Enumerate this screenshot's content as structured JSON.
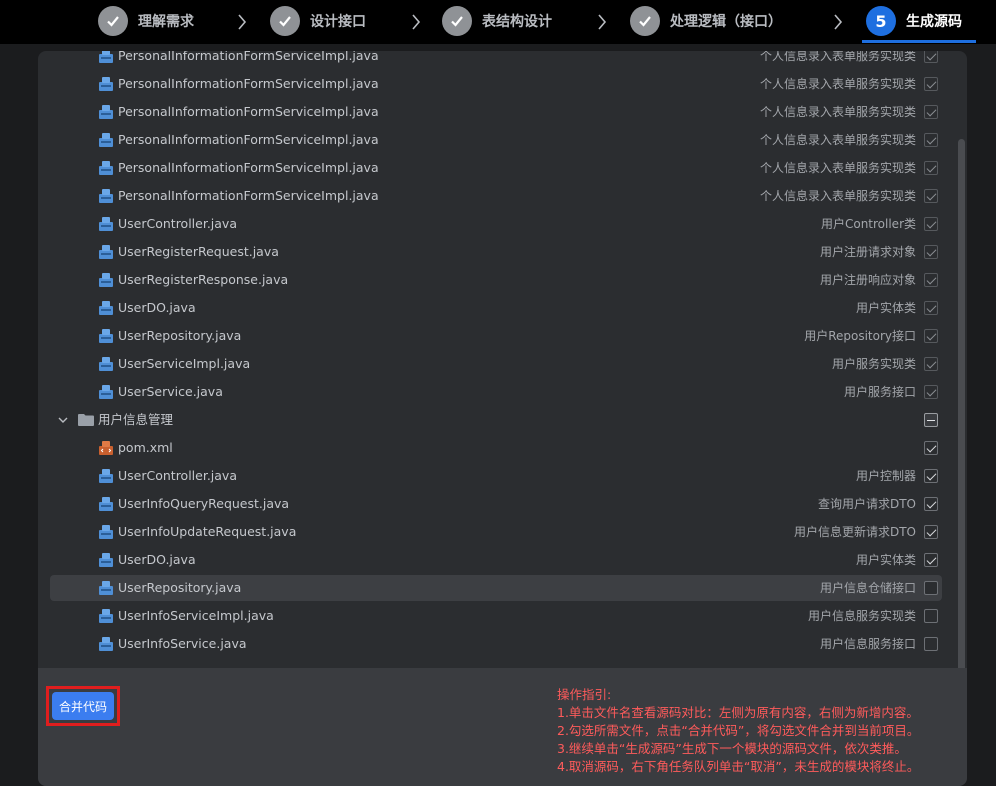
{
  "steps": [
    {
      "label": "理解需求",
      "status": "done"
    },
    {
      "label": "设计接口",
      "status": "done"
    },
    {
      "label": "表结构设计",
      "status": "done"
    },
    {
      "label": "处理逻辑（接口）",
      "status": "done"
    },
    {
      "label": "生成源码",
      "status": "active",
      "number": "5"
    }
  ],
  "tree": {
    "group1_files": [
      {
        "name": "PersonalInformationFormServiceImpl.java",
        "desc": "个人信息录入表单服务实现类",
        "checked": true
      },
      {
        "name": "PersonalInformationFormServiceImpl.java",
        "desc": "个人信息录入表单服务实现类",
        "checked": true
      },
      {
        "name": "PersonalInformationFormServiceImpl.java",
        "desc": "个人信息录入表单服务实现类",
        "checked": true
      },
      {
        "name": "PersonalInformationFormServiceImpl.java",
        "desc": "个人信息录入表单服务实现类",
        "checked": true
      },
      {
        "name": "PersonalInformationFormServiceImpl.java",
        "desc": "个人信息录入表单服务实现类",
        "checked": true
      },
      {
        "name": "PersonalInformationFormServiceImpl.java",
        "desc": "个人信息录入表单服务实现类",
        "checked": true
      },
      {
        "name": "UserController.java",
        "desc": "用户Controller类",
        "checked": true
      },
      {
        "name": "UserRegisterRequest.java",
        "desc": "用户注册请求对象",
        "checked": true
      },
      {
        "name": "UserRegisterResponse.java",
        "desc": "用户注册响应对象",
        "checked": true
      },
      {
        "name": "UserDO.java",
        "desc": "用户实体类",
        "checked": true
      },
      {
        "name": "UserRepository.java",
        "desc": "用户Repository接口",
        "checked": true
      },
      {
        "name": "UserServiceImpl.java",
        "desc": "用户服务实现类",
        "checked": true
      },
      {
        "name": "UserService.java",
        "desc": "用户服务接口",
        "checked": true
      }
    ],
    "folder": {
      "name": "用户信息管理",
      "state": "partial"
    },
    "group2_files": [
      {
        "name": "pom.xml",
        "desc": "",
        "checked": true,
        "icon": "xml-file-icon"
      },
      {
        "name": "UserController.java",
        "desc": "用户控制器",
        "checked": true
      },
      {
        "name": "UserInfoQueryRequest.java",
        "desc": "查询用户请求DTO",
        "checked": true
      },
      {
        "name": "UserInfoUpdateRequest.java",
        "desc": "用户信息更新请求DTO",
        "checked": true
      },
      {
        "name": "UserDO.java",
        "desc": "用户实体类",
        "checked": true
      },
      {
        "name": "UserRepository.java",
        "desc": "用户信息仓储接口",
        "checked": false,
        "highlight": true
      },
      {
        "name": "UserInfoServiceImpl.java",
        "desc": "用户信息服务实现类",
        "checked": false
      },
      {
        "name": "UserInfoService.java",
        "desc": "用户信息服务接口",
        "checked": false
      }
    ]
  },
  "bottom": {
    "merge_label": "合并代码",
    "guide_title": "操作指引:",
    "guide_lines": [
      "1.单击文件名查看源码对比：左侧为原有内容，右侧为新增内容。",
      "2.勾选所需文件，点击“合并代码”，将勾选文件合并到当前项目。",
      "3.继续单击“生成源码”生成下一个模块的源码文件，依次类推。",
      "4.取消源码，右下角任务队列单击“取消”，未生成的模块将终止。"
    ]
  },
  "colors": {
    "accent": "#1e6fe0",
    "button": "#3b7df0",
    "guide_text": "#ff5b5b",
    "highlight_border": "#e01e1e"
  }
}
